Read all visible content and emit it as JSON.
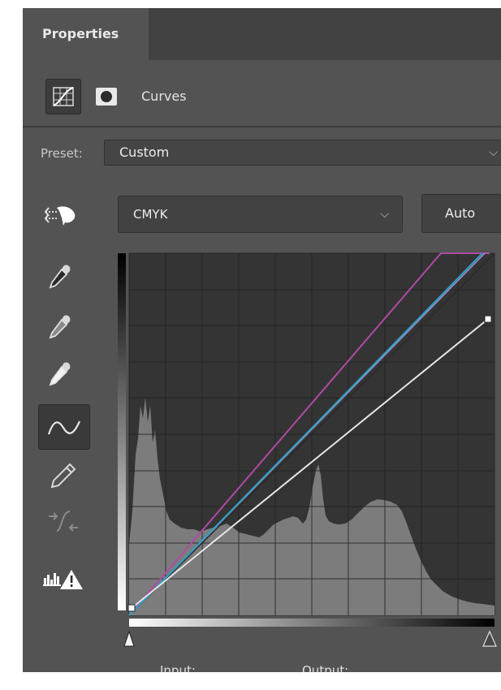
{
  "panel": {
    "tab_label": "Properties",
    "title": "Curves"
  },
  "preset": {
    "label": "Preset:",
    "value": "Custom"
  },
  "channel": {
    "value": "CMYK"
  },
  "auto_label": "Auto",
  "footer": {
    "input_label": "Input:",
    "output_label": "Output:"
  },
  "icons": {
    "adjustment_icon": "curves-adjustment-icon",
    "mask_icon": "layer-mask-icon",
    "tools": [
      "on-image-adjust-icon",
      "black-point-eyedropper-icon",
      "gray-point-eyedropper-icon",
      "white-point-eyedropper-icon",
      "curve-edit-icon",
      "pencil-icon",
      "smooth-curve-icon",
      "clipping-warning-icon"
    ]
  },
  "colors": {
    "panel_bg": "#535353",
    "tab_bar_bg": "#424242",
    "graph_bg": "#343434",
    "histogram": "#7c7c7c",
    "curve_composite": "#e6e6e6",
    "curve_magenta": "#b04aa4",
    "curve_cyan": "#2f9fc4"
  }
}
